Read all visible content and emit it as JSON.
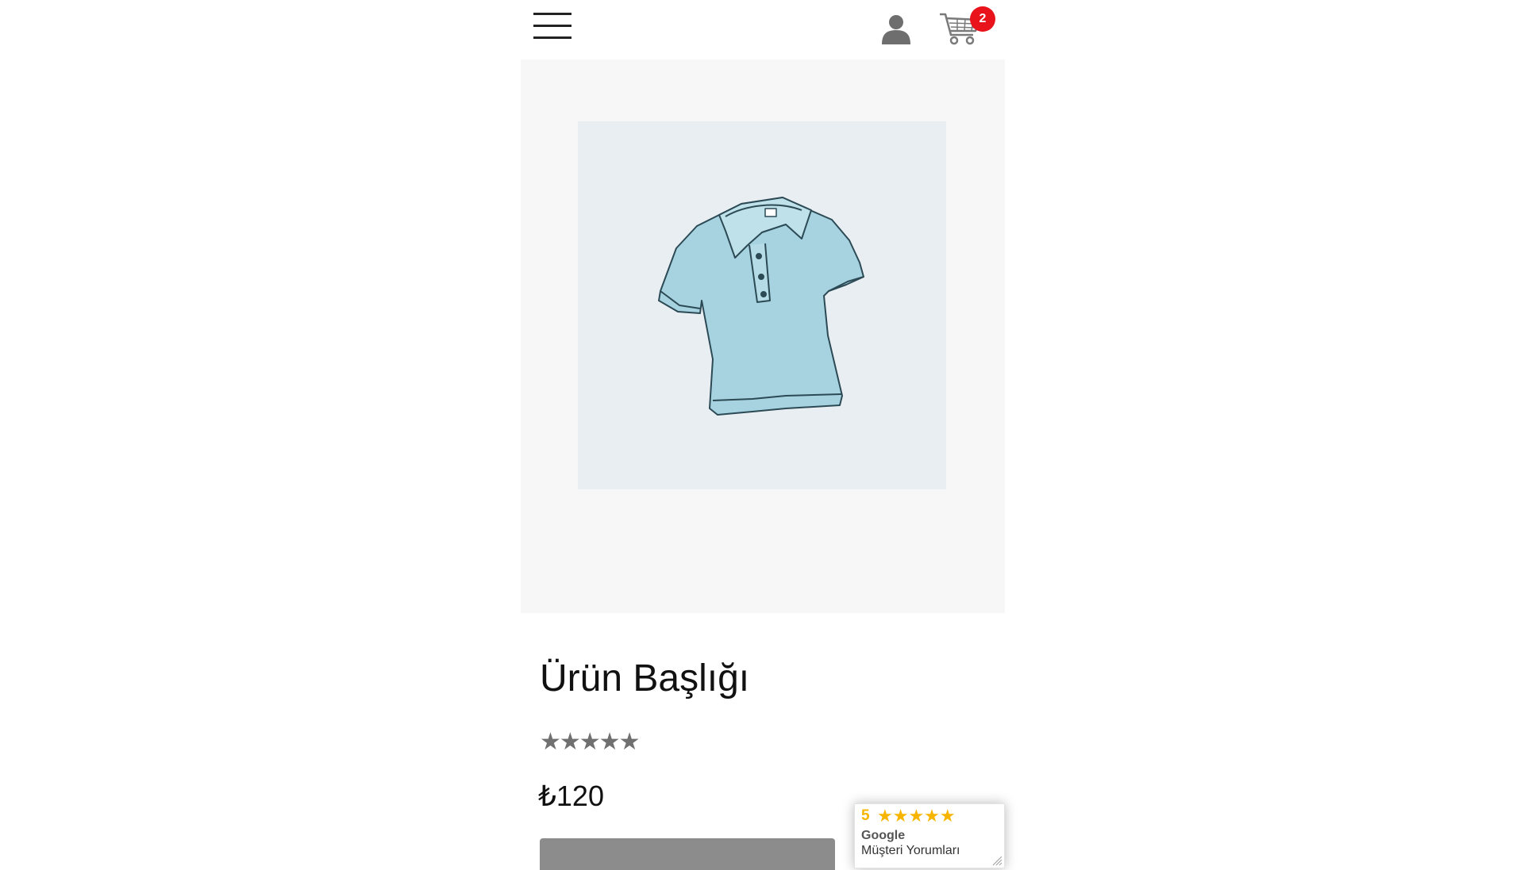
{
  "header": {
    "menu_icon": "hamburger-menu-icon",
    "user_icon": "user-icon",
    "cart_icon": "shopping-cart-icon",
    "cart_count": "2",
    "cart_badge_color": "#e8131b"
  },
  "product": {
    "image_icon": "polo-shirt-image",
    "title": "Ürün Başlığı",
    "rating_stars": "★★★★★",
    "price": "₺120"
  },
  "review_widget": {
    "score": "5",
    "stars": "★★★★★",
    "star_color": "#f7b500",
    "score_color": "#f7b500",
    "brand": "Google",
    "label": "Müşteri Yorumları"
  }
}
